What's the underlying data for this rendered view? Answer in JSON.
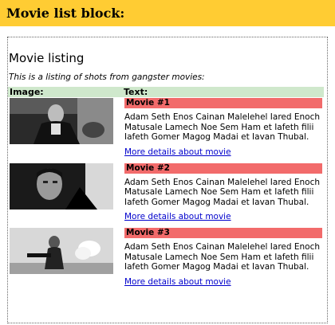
{
  "block_header": {
    "title": "Movie list block:"
  },
  "listing": {
    "title": "Movie listing",
    "intro": "This is a listing of shots from gangster movies:",
    "columns": {
      "image": "Image:",
      "text": "Text:"
    },
    "movies": [
      {
        "title": "Movie #1",
        "text": "Adam Seth Enos Cainan Malelehel Iared Enoch Matusale Lamech Noe Sem Ham et Iafeth filii Iafeth Gomer Magog Madai et Iavan Thubal.",
        "link": "More details about movie"
      },
      {
        "title": "Movie #2",
        "text": "Adam Seth Enos Cainan Malelehel Iared Enoch Matusale Lamech Noe Sem Ham et Iafeth filii Iafeth Gomer Magog Madai et Iavan Thubal.",
        "link": "More details about movie"
      },
      {
        "title": "Movie #3",
        "text": "Adam Seth Enos Cainan Malelehel Iared Enoch Matusale Lamech Noe Sem Ham et Iafeth filii Iafeth Gomer Magog Madai et Iavan Thubal.",
        "link": "More details about movie"
      }
    ]
  },
  "colors": {
    "header_bg": "#ffcc33",
    "column_header_bg": "#cfe8cc",
    "movie_title_bg": "#f26b6b",
    "link": "#0000cc"
  }
}
